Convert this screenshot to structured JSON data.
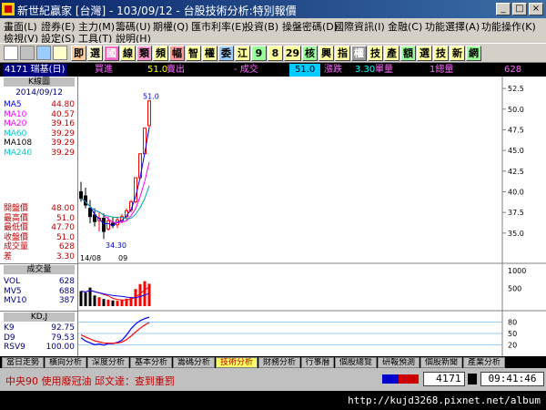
{
  "window": {
    "title": "新世紀贏家 [台灣] - 103/09/12 - 台股技術分析:特別報價",
    "buttons": [
      "_",
      "□",
      "×"
    ]
  },
  "menu": {
    "row1": [
      "畫面(L)",
      "證券(E)",
      "主力(M)",
      "籌碼(U)",
      "期權(Q)",
      "匯市利率(E)",
      "投資(B)",
      "操盤密碼(D)",
      "國際資訊(I)",
      "金融(C)",
      "功能選擇(A)",
      "功能操作(K)"
    ],
    "row2": [
      "檢視(V)",
      "設定(S)",
      "工具(T)",
      "說明(H)"
    ]
  },
  "toolbar": {
    "buttons": [
      {
        "label": "即",
        "bg": "#ffcc99",
        "fg": "#000000"
      },
      {
        "label": "選",
        "bg": "#ffffcc",
        "fg": "#000000"
      },
      {
        "label": "國",
        "bg": "#ff66cc",
        "fg": "#ffffff"
      },
      {
        "label": "線",
        "bg": "#ffff99",
        "fg": "#000000"
      },
      {
        "label": "類",
        "bg": "#ff99cc",
        "fg": "#000000"
      },
      {
        "label": "頻",
        "bg": "#ffff99",
        "fg": "#000000"
      },
      {
        "label": "幅",
        "bg": "#ff9999",
        "fg": "#000000"
      },
      {
        "label": "智",
        "bg": "#ffff99",
        "fg": "#000000"
      },
      {
        "label": "權",
        "bg": "#ffff99",
        "fg": "#000000"
      },
      {
        "label": "委",
        "bg": "#99ccff",
        "fg": "#000000"
      },
      {
        "label": "江",
        "bg": "#ffff99",
        "fg": "#000000"
      },
      {
        "label": "9",
        "bg": "#99ff99",
        "fg": "#000000"
      },
      {
        "label": "8",
        "bg": "#ffff99",
        "fg": "#000000"
      },
      {
        "label": "29",
        "bg": "#ffff99",
        "fg": "#000000"
      },
      {
        "label": "核",
        "bg": "#99ff99",
        "fg": "#000000"
      },
      {
        "label": "興",
        "bg": "#ffff99",
        "fg": "#000000"
      },
      {
        "label": "指",
        "bg": "#ffff99",
        "fg": "#000000"
      },
      {
        "label": "權",
        "bg": "#999999",
        "fg": "#ffffff"
      },
      {
        "label": "技",
        "bg": "#ffff99",
        "fg": "#000000"
      },
      {
        "label": "產",
        "bg": "#ffff99",
        "fg": "#000000"
      },
      {
        "label": "額",
        "bg": "#99ff99",
        "fg": "#000000"
      },
      {
        "label": "選",
        "bg": "#ffff99",
        "fg": "#000000"
      },
      {
        "label": "技",
        "bg": "#ffff99",
        "fg": "#000000"
      },
      {
        "label": "新",
        "bg": "#ffff99",
        "fg": "#000000"
      },
      {
        "label": "網",
        "bg": "#99ff99",
        "fg": "#000000"
      }
    ]
  },
  "quote": {
    "stock": "4171 瑞基(日)",
    "buy_label": "買進",
    "buy_value": "51.0",
    "sell_label": "賣出",
    "change_label": "- 成交",
    "last_price": "51.0",
    "updown_label": "漲跌",
    "change_value": "3.30",
    "volume_label": "單量",
    "lot_label": "1總量",
    "total_volume": "628"
  },
  "kline_panel": {
    "header": "K線圖",
    "date": "2014/09/12",
    "ma": [
      {
        "name": "MA5",
        "value": "44.80",
        "color": "#0000ff"
      },
      {
        "name": "MA10",
        "value": "40.57",
        "color": "#ff00ff"
      },
      {
        "name": "MA20",
        "value": "39.16",
        "color": "#ff00ff"
      },
      {
        "name": "MA60",
        "value": "39.29",
        "color": "#00cccc"
      },
      {
        "name": "MA108",
        "value": "39.29",
        "color": "#000000"
      },
      {
        "name": "MA240",
        "value": "39.29",
        "color": "#00cccc"
      }
    ],
    "ohlc": [
      {
        "name": "開盤價",
        "value": "48.00"
      },
      {
        "name": "最高價",
        "value": "51.0"
      },
      {
        "name": "最低價",
        "value": "47.70"
      },
      {
        "name": "收盤價",
        "value": "51.0"
      },
      {
        "name": "成交量",
        "value": "628"
      },
      {
        "name": "差",
        "value": "3.30"
      }
    ],
    "xaxis_left": "14/08",
    "xaxis_mid": "09"
  },
  "volume_panel": {
    "header": "成交量",
    "rows": [
      {
        "name": "VOL",
        "value": "628"
      },
      {
        "name": "MV5",
        "value": "688"
      },
      {
        "name": "MV10",
        "value": "387"
      }
    ],
    "yaxis": [
      "1000",
      "500"
    ]
  },
  "kdj_panel": {
    "header": "KD,J",
    "rows": [
      {
        "name": "K9",
        "value": "92.75"
      },
      {
        "name": "D9",
        "value": "79.53"
      },
      {
        "name": "RSV9",
        "value": "100.00"
      }
    ],
    "yaxis": [
      "80",
      "50",
      "20"
    ]
  },
  "chart_data": {
    "type": "candlestick",
    "y_ticks": [
      "52.5",
      "50.0",
      "47.5",
      "45.0",
      "42.5",
      "40.0",
      "37.5",
      "35.0"
    ],
    "ylim": [
      33.0,
      53.5
    ],
    "peak_label": "51.0",
    "low_label": "34.30",
    "candles": [
      {
        "o": 40.0,
        "h": 41.2,
        "l": 38.8,
        "c": 39.2
      },
      {
        "o": 39.5,
        "h": 40.5,
        "l": 38.0,
        "c": 38.4
      },
      {
        "o": 38.0,
        "h": 39.0,
        "l": 36.2,
        "c": 37.0
      },
      {
        "o": 37.2,
        "h": 38.0,
        "l": 35.8,
        "c": 36.4
      },
      {
        "o": 36.5,
        "h": 37.5,
        "l": 35.2,
        "c": 36.8
      },
      {
        "o": 36.8,
        "h": 37.4,
        "l": 34.3,
        "c": 35.2
      },
      {
        "o": 35.5,
        "h": 37.0,
        "l": 35.3,
        "c": 36.5
      },
      {
        "o": 36.2,
        "h": 37.0,
        "l": 35.6,
        "c": 35.9
      },
      {
        "o": 36.0,
        "h": 37.0,
        "l": 35.6,
        "c": 36.6
      },
      {
        "o": 36.5,
        "h": 37.3,
        "l": 36.2,
        "c": 37.0
      },
      {
        "o": 37.0,
        "h": 38.0,
        "l": 36.6,
        "c": 37.7
      },
      {
        "o": 37.8,
        "h": 39.0,
        "l": 37.5,
        "c": 38.8
      },
      {
        "o": 38.8,
        "h": 41.7,
        "l": 38.6,
        "c": 41.7
      },
      {
        "o": 41.7,
        "h": 44.6,
        "l": 41.5,
        "c": 44.6
      },
      {
        "o": 44.6,
        "h": 47.7,
        "l": 44.5,
        "c": 47.7
      },
      {
        "o": 48.0,
        "h": 51.0,
        "l": 47.7,
        "c": 51.0
      }
    ],
    "volume": [
      420,
      380,
      520,
      300,
      250,
      200,
      180,
      160,
      150,
      180,
      210,
      260,
      480,
      620,
      700,
      628
    ]
  },
  "tabs": [
    "當日走勢",
    "橫向分析",
    "深度分析",
    "基本分析",
    "籌碼分析",
    "技術分析",
    "財務分析",
    "行事曆",
    "個股總覽",
    "研報預測",
    "個股新聞",
    "產業分析"
  ],
  "active_tab": 5,
  "status": {
    "ticker": "中央90  使用廢冠油  邱文達：查到重罰",
    "code": "4171",
    "clock": "09:41:46"
  },
  "watermark": "http://kujd3268.pixnet.net/album"
}
